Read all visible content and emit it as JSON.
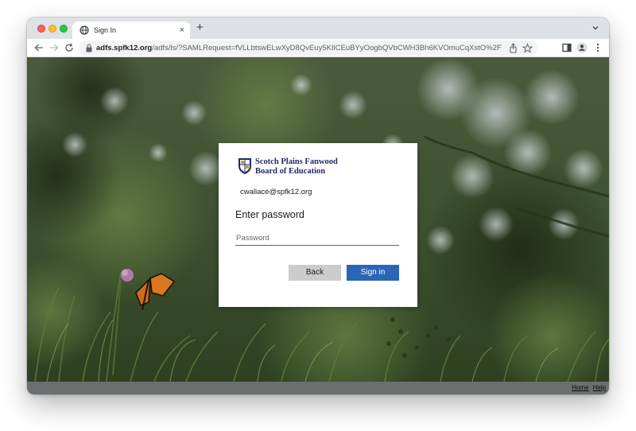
{
  "browser": {
    "tab_title": "Sign In",
    "tab_close": "×",
    "new_tab": "+",
    "url_host": "adfs.spfk12.org",
    "url_path": "/adfs/ls/?SAMLRequest=fVLLbtswELwXyD8QvEuy5KIlCEuBYyOogbQVbCWH3Bh6KVOmuCqXstO%2FryzHcHporsPZ..."
  },
  "signin": {
    "org_line1": "Scotch Plains Fanwood",
    "org_line2": "Board of Education",
    "username_bold": "cwallace",
    "username_domain": "@spfk12.org",
    "heading": "Enter password",
    "password_placeholder": "Password",
    "password_value": "",
    "back_label": "Back",
    "signin_label": "Sign in"
  },
  "footer": {
    "home_label": "Home",
    "help_label": "Help"
  },
  "colors": {
    "accent": "#2b66b6",
    "org_blue": "#1f2a6b",
    "back_button": "#cccccc",
    "footer_bar": "#6b6f70"
  },
  "icons": {
    "tab_favicon": "globe-icon",
    "back": "arrow-left-icon",
    "forward": "arrow-right-icon",
    "reload": "reload-icon",
    "lock": "lock-icon",
    "share": "share-icon",
    "bookmark": "star-icon",
    "side_panel": "side-panel-icon",
    "profile": "profile-icon",
    "menu": "kebab-menu-icon",
    "tab_list": "chevron-down-icon"
  }
}
